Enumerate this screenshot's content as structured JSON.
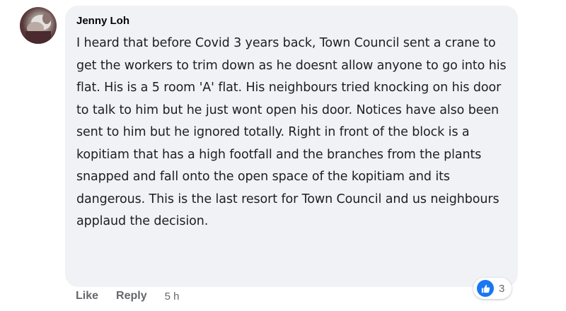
{
  "comment": {
    "author": "Jenny Loh",
    "text": "I heard that before Covid 3 years back, Town Council sent a crane to get the workers to trim down as he doesnt allow anyone to go into his flat. His is a 5 room 'A' flat. His neighbours tried knocking on his door to talk to him but he just wont open his door. Notices have also been sent to him but he ignored totally. Right in front of the block is a kopitiam that has a high footfall and the branches from the plants snapped and fall onto the open space of the kopitiam and its dangerous. This is the last resort for Town Council and us neighbours applaud the decision.",
    "actions": {
      "like_label": "Like",
      "reply_label": "Reply",
      "timestamp": "5 h"
    },
    "reactions": {
      "icon": "like-icon",
      "count": "3",
      "color": "#1877f2"
    }
  }
}
